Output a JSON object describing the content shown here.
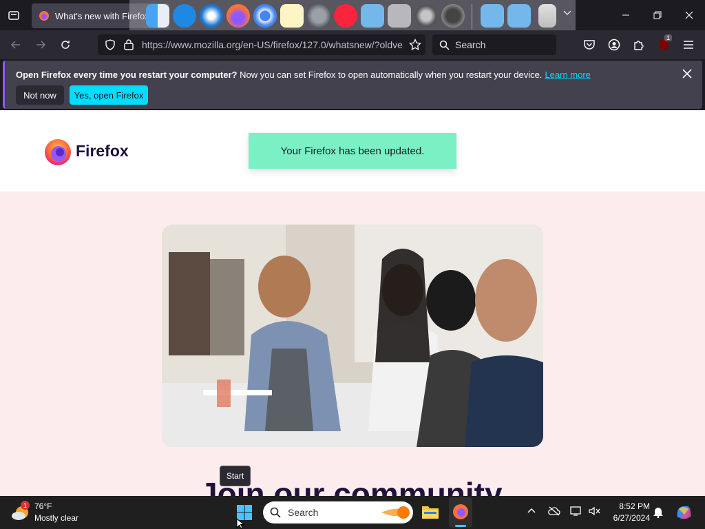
{
  "browser": {
    "tab_title": "What's new with Firefox -",
    "url": "https://www.mozilla.org/en-US/firefox/127.0/whatsnew/?oldve",
    "search_placeholder": "Search",
    "extension_badge": "1"
  },
  "notification": {
    "bold_text": "Open Firefox every time you restart your computer?",
    "text": " Now you can set Firefox to open automatically when you restart your device.",
    "link": "Learn more",
    "not_now": "Not now",
    "yes_button": "Yes, open Firefox"
  },
  "page": {
    "logo_text": "Firefox",
    "update_message": "Your Firefox has been updated.",
    "heading": "Join our community",
    "accent_color": "#7af0c4",
    "background_color": "#fdeced"
  },
  "tooltip": "Start",
  "taskbar": {
    "weather_temp": "76°F",
    "weather_desc": "Mostly clear",
    "weather_badge": "1",
    "search_placeholder": "Search",
    "time": "8:52 PM",
    "date": "6/27/2024"
  }
}
